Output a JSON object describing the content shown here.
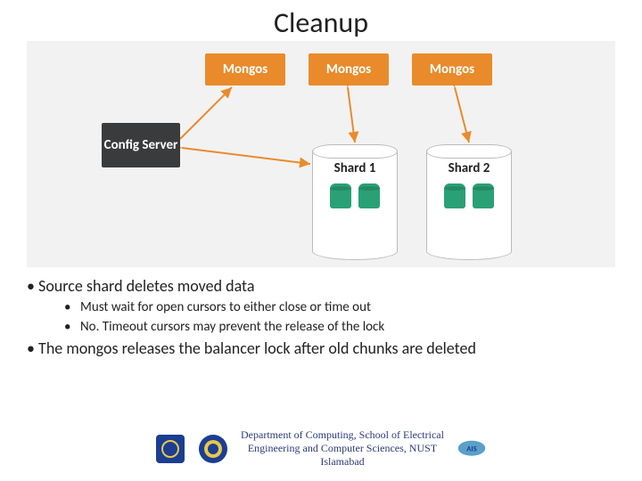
{
  "title": "Cleanup",
  "diagram": {
    "mongos": [
      "Mongos",
      "Mongos",
      "Mongos"
    ],
    "config": "Config Server",
    "shards": [
      "Shard 1",
      "Shard 2"
    ]
  },
  "bullets": {
    "b1": "Source shard deletes moved data",
    "b1_sub": [
      "Must wait for open cursors to either close or time out",
      "No. Timeout cursors may prevent the release of the lock"
    ],
    "b2_pre": "The ",
    "b2_code": "mongos",
    "b2_post": " releases the balancer lock after old chunks are deleted"
  },
  "footer": {
    "dept_line1": "Department of Computing, School of Electrical",
    "dept_line2": "Engineering and Computer Sciences, NUST",
    "dept_line3": "Islamabad"
  },
  "colors": {
    "mongos_bg": "#e98b2b",
    "config_bg": "#3a3b3c",
    "doc_green": "#2aa076",
    "arrow": "#e98b2b"
  }
}
